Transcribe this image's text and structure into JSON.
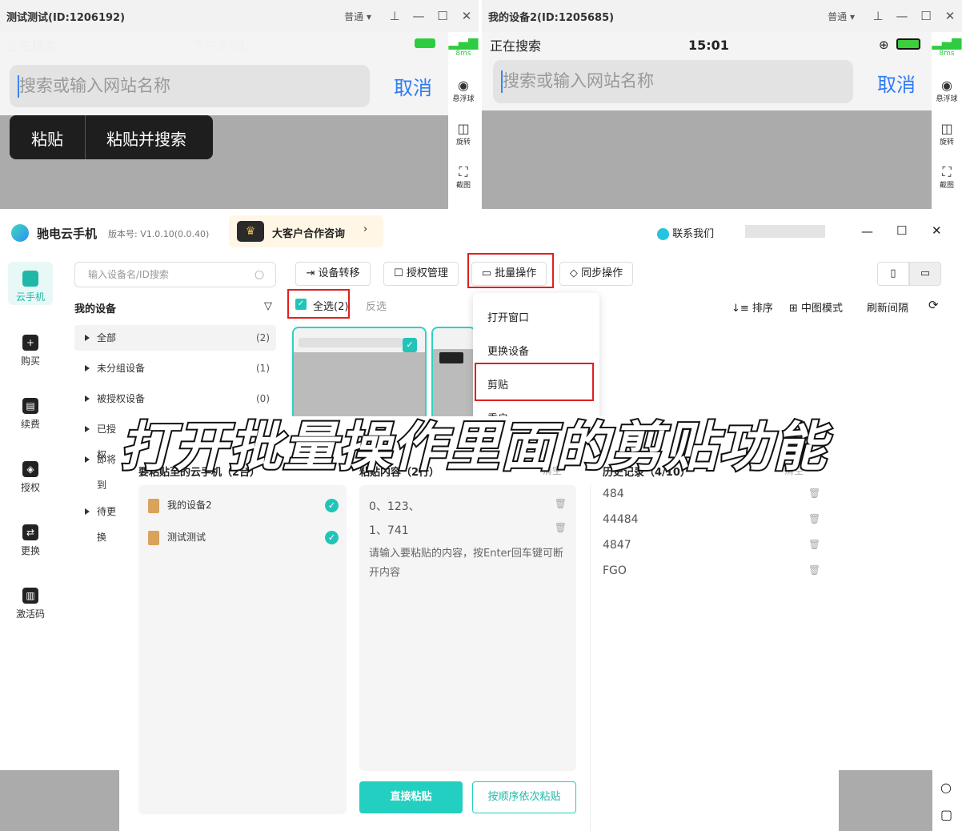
{
  "left_window": {
    "title": "测试测试(ID:1206192)",
    "mode": "普通",
    "status_left": "正在搜索",
    "status_time": "下午3:01",
    "search_placeholder": "搜索或输入网站名称",
    "cancel": "取消",
    "popup": [
      "粘贴",
      "粘贴并搜索"
    ],
    "latency": "8ms"
  },
  "right_window": {
    "title": "我的设备2(ID:1205685)",
    "mode": "普通",
    "status_left": "正在搜索",
    "status_time": "15:01",
    "search_placeholder": "搜索或输入网站名称",
    "cancel": "取消",
    "latency": "8ms"
  },
  "side_tools": [
    "悬浮球",
    "旋转",
    "截图"
  ],
  "app": {
    "name": "驰电云手机",
    "version": "版本号: V1.0.10(0.0.40)",
    "vip": "大客户合作咨询",
    "contact": "联系我们"
  },
  "nav": [
    "云手机",
    "购买",
    "续费",
    "授权",
    "更换",
    "激活码"
  ],
  "search_placeholder": "输入设备名/ID搜索",
  "my_devices": "我的设备",
  "tree": [
    {
      "label": "全部",
      "count": "(2)"
    },
    {
      "label": "未分组设备",
      "count": "(1)"
    },
    {
      "label": "被授权设备",
      "count": "(0)"
    },
    {
      "label": "已授权",
      "count": ""
    },
    {
      "label": "即将到",
      "count": ""
    },
    {
      "label": "待更换",
      "count": ""
    }
  ],
  "toolbar": [
    "设备转移",
    "授权管理",
    "批量操作",
    "同步操作"
  ],
  "select_all": "全选(2)",
  "invert": "反选",
  "right_tools": [
    "排序",
    "中图模式",
    "刷新间隔"
  ],
  "menu": [
    "打开窗口",
    "更换设备",
    "剪贴",
    "重启"
  ],
  "dialog": {
    "devices_header": "要粘贴至的云手机（2台）",
    "content_header": "粘贴内容（2行）",
    "history_header": "历史记录（4/10）",
    "clear": "清空",
    "devices": [
      "我的设备2",
      "测试测试"
    ],
    "contents": [
      "0、123、",
      "1、741"
    ],
    "input_hint": "请输入要粘贴的内容，按Enter回车键可断开内容",
    "history": [
      "484",
      "44484",
      "4847",
      "FGO"
    ],
    "btn_direct": "直接粘贴",
    "btn_order": "按顺序依次粘贴"
  },
  "overlay": "打开批量操作里面的剪贴功能"
}
